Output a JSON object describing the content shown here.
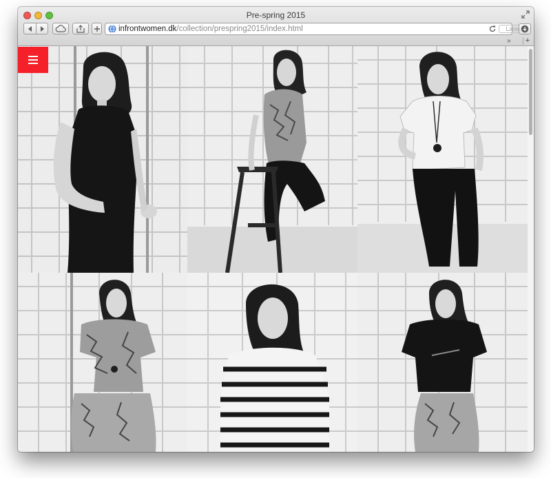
{
  "window": {
    "title": "Pre-spring 2015"
  },
  "toolbar": {
    "url_host": "infrontwomen.dk",
    "url_path": "/collection/prespring2015/index.html",
    "reader_label": "Læser",
    "tab_overflow": "»",
    "new_tab": "+"
  },
  "site": {
    "accent_color": "#f6202a",
    "menu_icon": "hamburger-menu-icon"
  },
  "gallery": {
    "columns": 3,
    "rows": 2,
    "photos": [
      {
        "description": "woman in black sleeveless tunic"
      },
      {
        "description": "woman seated on stool in paisley top and leather trousers"
      },
      {
        "description": "woman in light tee with pendant necklace and leather trousers"
      },
      {
        "description": "woman in paisley top and paisley trousers"
      },
      {
        "description": "woman in striped sweater"
      },
      {
        "description": "woman in black top with zip and paisley trousers"
      }
    ]
  }
}
